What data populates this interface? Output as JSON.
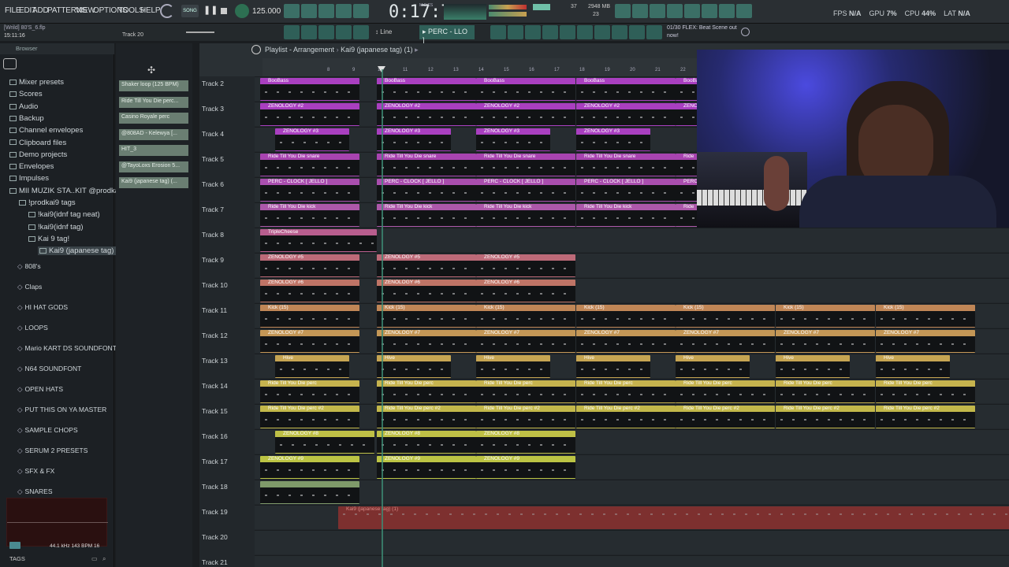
{
  "menu": [
    "FILE",
    "EDIT",
    "ADD",
    "PATTERNS",
    "VIEW",
    "OPTIONS",
    "TOOLS",
    "HELP"
  ],
  "song_mode": "SONG",
  "tempo": "125.000",
  "time": "0:17:77",
  "time_unit": "M:S:CS",
  "memory": "2948 MB",
  "cpu_small": "37",
  "voices": "23",
  "stats": {
    "fps_label": "FPS",
    "fps": "N/A",
    "gpu_label": "GPU",
    "gpu": "7%",
    "cpu_label": "CPU",
    "cpu": "44%",
    "lat_label": "LAT",
    "lat": "N/A"
  },
  "hint": {
    "counter": "01/30",
    "text": "FLEX: Beat Scene out now!"
  },
  "window_title": "[Wrild] 80'S_6.flp",
  "clock": "15:11:16",
  "track_indicator": "Track 20",
  "snap": "Line",
  "pattern_name": "PERC - LLO ]",
  "browser_title": "Browser",
  "browser_items": [
    {
      "label": "Mixer presets",
      "indent": 0
    },
    {
      "label": "Scores",
      "indent": 0
    },
    {
      "label": "Audio",
      "indent": 0
    },
    {
      "label": "Backup",
      "indent": 0
    },
    {
      "label": "Channel envelopes",
      "indent": 0
    },
    {
      "label": "Clipboard files",
      "indent": 0
    },
    {
      "label": "Demo projects",
      "indent": 0
    },
    {
      "label": "Envelopes",
      "indent": 0
    },
    {
      "label": "Impulses",
      "indent": 0
    },
    {
      "label": "MII MUZIK STA..KIT @prodkai9",
      "indent": 0
    },
    {
      "label": "!prodkai9 tags",
      "indent": 1
    },
    {
      "label": "!kai9(idnf tag neat)",
      "indent": 2
    },
    {
      "label": "!kai9(idnf tag)",
      "indent": 2
    },
    {
      "label": "Kai 9 tag!",
      "indent": 2
    },
    {
      "label": "Kai9 (japanese tag) (1)",
      "indent": 3
    },
    {
      "label": "808's",
      "indent": 1
    },
    {
      "label": "Claps",
      "indent": 1
    },
    {
      "label": "HI HAT GODS",
      "indent": 1
    },
    {
      "label": "LOOPS",
      "indent": 1
    },
    {
      "label": "Mario KART DS SOUNDFONT",
      "indent": 1
    },
    {
      "label": "N64 SOUNDFONT",
      "indent": 1
    },
    {
      "label": "OPEN HATS",
      "indent": 1
    },
    {
      "label": "PUT THIS ON YA MASTER",
      "indent": 1
    },
    {
      "label": "SAMPLE CHOPS",
      "indent": 1
    },
    {
      "label": "SERUM 2 PRESETS",
      "indent": 1
    },
    {
      "label": "SFX & FX",
      "indent": 1
    },
    {
      "label": "SNARES",
      "indent": 1
    }
  ],
  "preview_info": "44.1 kHz 143 BPM 16",
  "tags_label": "TAGS",
  "channels": [
    "Shaker loop (125 BPM)",
    "Ride Till You Die perc...",
    "Casino Royale perc",
    "@808AD - Kelewya [...",
    "HIT_3",
    "@TayoLoxs Erosion 5...",
    "Kai9 (japanese tag) (..."
  ],
  "playlist_title": "Playlist - Arrangement",
  "playlist_pattern": "Kai9 (japanese tag) (1)",
  "ruler": [
    "8",
    "9",
    "10",
    "11",
    "12",
    "13",
    "14",
    "15",
    "16",
    "17",
    "18",
    "19",
    "20",
    "21",
    "22"
  ],
  "tracks": [
    {
      "name": "Track 2",
      "clips": [
        {
          "label": "BooBass",
          "color": "#a93fc0"
        },
        {
          "label": "BooBass",
          "color": "#a93fc0"
        },
        {
          "label": "BooBass",
          "color": "#a93fc0"
        },
        {
          "label": "BooBass",
          "color": "#a93fc0"
        },
        {
          "label": "BooBass",
          "color": "#a93fc0"
        }
      ]
    },
    {
      "name": "Track 3",
      "clips": [
        {
          "label": "ZENOLOGY #2",
          "color": "#a93fc0"
        },
        {
          "label": "ZENOLOGY #2",
          "color": "#a93fc0"
        },
        {
          "label": "ZENOLOGY #2",
          "color": "#a93fc0"
        },
        {
          "label": "ZENOLOGY #2",
          "color": "#a93fc0"
        },
        {
          "label": "ZENOLOGY #2",
          "color": "#a93fc0"
        }
      ]
    },
    {
      "name": "Track 4",
      "clips": [
        {
          "label": "ZENOLOGY #3",
          "color": "#a93fc0"
        },
        {
          "label": "ZENOLOGY #3",
          "color": "#a93fc0"
        },
        {
          "label": "ZENOLOGY #3",
          "color": "#a93fc0"
        },
        {
          "label": "ZENOLOGY #3",
          "color": "#a93fc0"
        }
      ]
    },
    {
      "name": "Track 5",
      "clips": [
        {
          "label": "Ride Till You Die snare",
          "color": "#a844b0"
        },
        {
          "label": "Ride Till You Die snare",
          "color": "#a844b0"
        },
        {
          "label": "Ride Till You Die snare",
          "color": "#a844b0"
        },
        {
          "label": "Ride Till You Die snare",
          "color": "#a844b0"
        },
        {
          "label": "Ride",
          "color": "#a844b0"
        }
      ]
    },
    {
      "name": "Track 6",
      "clips": [
        {
          "label": "PERC - CLOCK [ JELLO ]",
          "color": "#a94eae"
        },
        {
          "label": "PERC - CLOCK [ JELLO ]",
          "color": "#a94eae"
        },
        {
          "label": "PERC - CLOCK [ JELLO ]",
          "color": "#a94eae"
        },
        {
          "label": "PERC - CLOCK [ JELLO ]",
          "color": "#a94eae"
        },
        {
          "label": "PERC",
          "color": "#a94eae"
        }
      ]
    },
    {
      "name": "Track 7",
      "clips": [
        {
          "label": "Ride Till You Die kick",
          "color": "#ad58aa"
        },
        {
          "label": "Ride Till You Die kick",
          "color": "#ad58aa"
        },
        {
          "label": "Ride Till You Die kick",
          "color": "#ad58aa"
        },
        {
          "label": "Ride Till You Die kick",
          "color": "#ad58aa"
        },
        {
          "label": "Ride",
          "color": "#ad58aa"
        }
      ]
    },
    {
      "name": "Track 8",
      "clips": [
        {
          "label": "TripleCheese",
          "color": "#b85e8e"
        }
      ]
    },
    {
      "name": "Track 9",
      "clips": [
        {
          "label": "ZENOLOGY #5",
          "color": "#bd6a78"
        },
        {
          "label": "ZENOLOGY #5",
          "color": "#bd6a78"
        },
        {
          "label": "ZENOLOGY #5",
          "color": "#bd6a78"
        }
      ]
    },
    {
      "name": "Track 10",
      "clips": [
        {
          "label": "ZENOLOGY #6",
          "color": "#bf7466"
        },
        {
          "label": "ZENOLOGY #6",
          "color": "#bf7466"
        },
        {
          "label": "ZENOLOGY #6",
          "color": "#bf7466"
        }
      ]
    },
    {
      "name": "Track 11",
      "clips": [
        {
          "label": "Kick (15)",
          "color": "#c08656"
        },
        {
          "label": "Kick (15)",
          "color": "#c08656"
        },
        {
          "label": "Kick (15)",
          "color": "#c08656"
        },
        {
          "label": "Kick (15)",
          "color": "#c08656"
        },
        {
          "label": "Kick (15)",
          "color": "#c08656"
        },
        {
          "label": "Kick (15)",
          "color": "#c08656"
        },
        {
          "label": "Kick (15)",
          "color": "#c08656"
        }
      ]
    },
    {
      "name": "Track 12",
      "clips": [
        {
          "label": "ZENOLOGY #7",
          "color": "#c49756"
        },
        {
          "label": "ZENOLOGY #7",
          "color": "#c49756"
        },
        {
          "label": "ZENOLOGY #7",
          "color": "#c49756"
        },
        {
          "label": "ZENOLOGY #7",
          "color": "#c49756"
        },
        {
          "label": "ZENOLOGY #7",
          "color": "#c49756"
        },
        {
          "label": "ZENOLOGY #7",
          "color": "#c49756"
        },
        {
          "label": "ZENOLOGY #7",
          "color": "#c49756"
        }
      ]
    },
    {
      "name": "Track 13",
      "clips": [
        {
          "label": "Hive",
          "color": "#c6a552"
        },
        {
          "label": "Hive",
          "color": "#c6a552"
        },
        {
          "label": "Hive",
          "color": "#c6a552"
        },
        {
          "label": "Hive",
          "color": "#c6a552"
        },
        {
          "label": "Hive",
          "color": "#c6a552"
        },
        {
          "label": "Hive",
          "color": "#c6a552"
        },
        {
          "label": "Hive",
          "color": "#c6a552"
        }
      ]
    },
    {
      "name": "Track 14",
      "clips": [
        {
          "label": "Ride Till You Die perc",
          "color": "#c6b34e"
        },
        {
          "label": "Ride Till You Die perc",
          "color": "#c6b34e"
        },
        {
          "label": "Ride Till You Die perc",
          "color": "#c6b34e"
        },
        {
          "label": "Ride Till You Die perc",
          "color": "#c6b34e"
        },
        {
          "label": "Ride Till You Die perc",
          "color": "#c6b34e"
        },
        {
          "label": "Ride Till You Die perc",
          "color": "#c6b34e"
        },
        {
          "label": "Ride Till You Die perc",
          "color": "#c6b34e"
        }
      ]
    },
    {
      "name": "Track 15",
      "clips": [
        {
          "label": "Ride Till You Die perc #2",
          "color": "#c3b84a"
        },
        {
          "label": "Ride Till You Die perc #2",
          "color": "#c3b84a"
        },
        {
          "label": "Ride Till You Die perc #2",
          "color": "#c3b84a"
        },
        {
          "label": "Ride Till You Die perc #2",
          "color": "#c3b84a"
        },
        {
          "label": "Ride Till You Die perc #2",
          "color": "#c3b84a"
        },
        {
          "label": "Ride Till You Die perc #2",
          "color": "#c3b84a"
        },
        {
          "label": "Ride Till You Die perc #2",
          "color": "#c3b84a"
        }
      ]
    },
    {
      "name": "Track 16",
      "clips": [
        {
          "label": "ZENOLOGY #8",
          "color": "#bfc046"
        },
        {
          "label": "ZENOLOGY #8",
          "color": "#bfc046"
        },
        {
          "label": "ZENOLOGY #8",
          "color": "#bfc046"
        }
      ]
    },
    {
      "name": "Track 17",
      "clips": [
        {
          "label": "ZENOLOGY #9",
          "color": "#bcc444"
        },
        {
          "label": "ZENOLOGY #9",
          "color": "#bcc444"
        },
        {
          "label": "ZENOLOGY #9",
          "color": "#bcc444"
        }
      ]
    },
    {
      "name": "Track 18",
      "clips": [
        {
          "label": "",
          "color": "#7f9a6a"
        }
      ]
    },
    {
      "name": "Track 19",
      "clips": [
        {
          "label": "Kai9 (japanese tag) (1)",
          "color": "#b8342f"
        }
      ]
    },
    {
      "name": "Track 20",
      "clips": []
    },
    {
      "name": "Track 21",
      "clips": []
    }
  ]
}
